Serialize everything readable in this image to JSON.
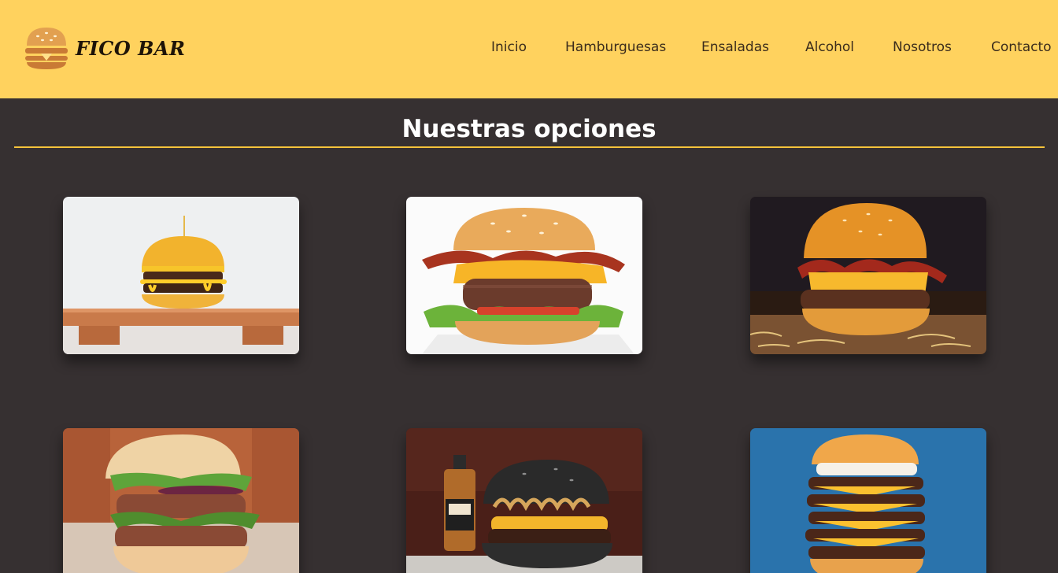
{
  "brand": {
    "name": "FICO BAR",
    "logo_icon": "burger-icon"
  },
  "nav": {
    "items": [
      {
        "label": "Inicio"
      },
      {
        "label": "Hamburguesas"
      },
      {
        "label": "Ensaladas"
      },
      {
        "label": "Alcohol"
      },
      {
        "label": "Nosotros"
      },
      {
        "label": "Contacto"
      }
    ]
  },
  "section": {
    "title": "Nuestras opciones"
  },
  "colors": {
    "header": "#ffd25e",
    "background": "#363031",
    "accent_rule": "#f5c33b",
    "title": "#ffffff"
  },
  "cards": [
    {
      "image": "burger-photo-1"
    },
    {
      "image": "burger-photo-2"
    },
    {
      "image": "burger-photo-3"
    },
    {
      "image": "burger-photo-4"
    },
    {
      "image": "burger-photo-5"
    },
    {
      "image": "burger-photo-6"
    }
  ]
}
